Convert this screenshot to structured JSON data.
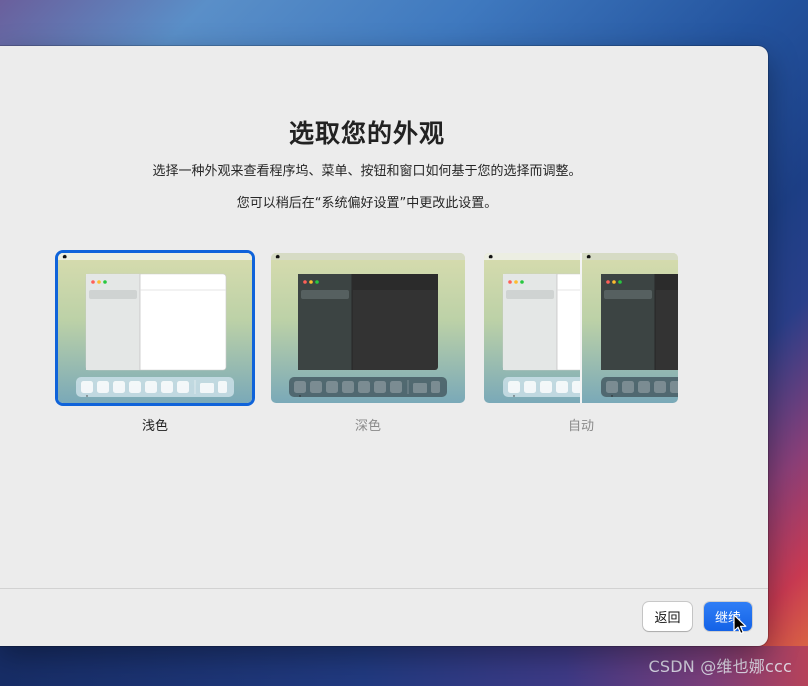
{
  "dialog": {
    "title": "选取您的外观",
    "subtitle": "选择一种外观来查看程序坞、菜单、按钮和窗口如何基于您的选择而调整。",
    "note": "您可以稍后在“系统偏好设置”中更改此设置。"
  },
  "appearance_options": [
    {
      "label": "浅色",
      "selected": true
    },
    {
      "label": "深色",
      "selected": false
    },
    {
      "label": "自动",
      "selected": false
    }
  ],
  "footer": {
    "back_label": "返回",
    "continue_label": "继续"
  },
  "watermark": "CSDN @维也娜ccc",
  "colors": {
    "accent": "#0f63da",
    "window_bg": "#ececec",
    "continue_button": "#1462e6"
  }
}
